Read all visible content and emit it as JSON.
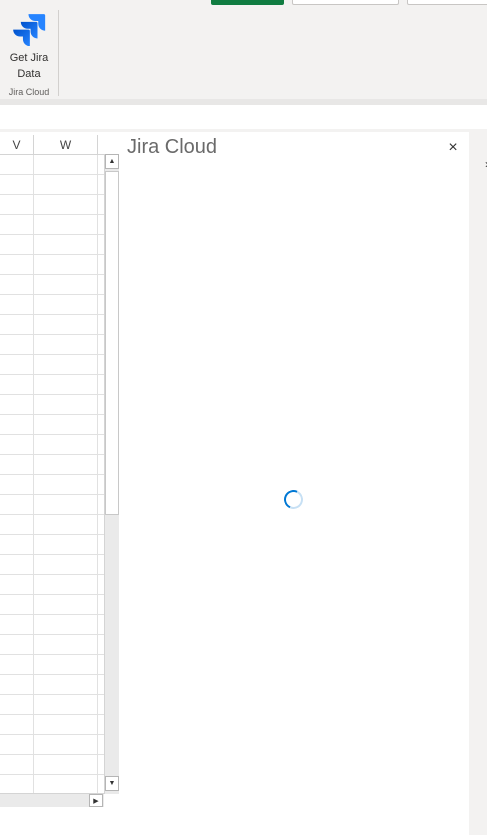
{
  "ribbon": {
    "get_jira_label_line1": "Get Jira",
    "get_jira_label_line2": "Data",
    "group_label": "Jira Cloud",
    "icon": "jira-logo-icon"
  },
  "sheet": {
    "columns": [
      "V",
      "W"
    ]
  },
  "pane": {
    "title": "Jira Cloud",
    "close_label": "×",
    "status": "loading"
  },
  "colors": {
    "accent": "#0078d4",
    "ribbon_bg": "#f3f2f1",
    "excel_green": "#107c41",
    "jira_blue": "#2684ff"
  }
}
